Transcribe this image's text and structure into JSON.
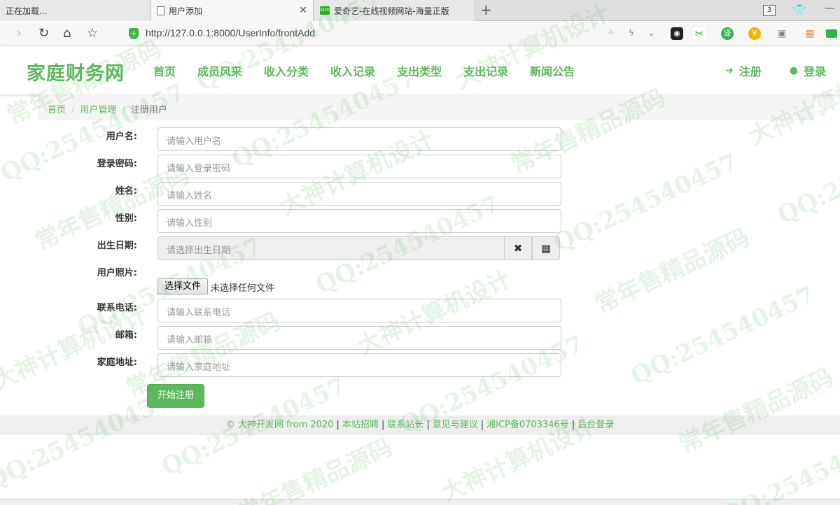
{
  "browser": {
    "tabs": [
      {
        "title": "正在加载..."
      },
      {
        "title": "用户添加"
      },
      {
        "title": "爱奇艺-在线视频网站-海量正版"
      }
    ],
    "tab_count": "3",
    "url": "http://127.0.0.1:8000/UserInfo/frontAdd"
  },
  "header": {
    "brand": "家庭财务网",
    "nav": [
      "首页",
      "成员风采",
      "收入分类",
      "收入记录",
      "支出类型",
      "支出记录",
      "新闻公告"
    ],
    "register": "注册",
    "login": "登录"
  },
  "breadcrumb": [
    "首页",
    "用户管理",
    "注册用户"
  ],
  "form": {
    "fields": [
      {
        "label": "用户名:",
        "placeholder": "请输入用户名"
      },
      {
        "label": "登录密码:",
        "placeholder": "请输入登录密码"
      },
      {
        "label": "姓名:",
        "placeholder": "请输入姓名"
      },
      {
        "label": "性别:",
        "placeholder": "请输入性别"
      },
      {
        "label": "出生日期:",
        "placeholder": "请选择出生日期"
      },
      {
        "label": "用户照片:"
      },
      {
        "label": "联系电话:",
        "placeholder": "请输入联系电话"
      },
      {
        "label": "邮箱:",
        "placeholder": "请输入邮箱"
      },
      {
        "label": "家庭地址:",
        "placeholder": "请输入家庭地址"
      }
    ],
    "file_button": "选择文件",
    "file_status": "未选择任何文件",
    "submit": "开始注册"
  },
  "footer": {
    "copyright": "© 大神开发网 from 2020",
    "links": [
      "本站招聘",
      "联系站长",
      "意见与建议",
      "湘ICP备0703346号",
      "后台登录"
    ]
  },
  "watermark": [
    "QQ:254540457",
    "常年售精品源码",
    "大神计算机设计"
  ],
  "colors": {
    "accent": "#5cb85c",
    "breadcrumb_bg": "#f5f5f5",
    "footer_bg": "#eeeeee"
  }
}
